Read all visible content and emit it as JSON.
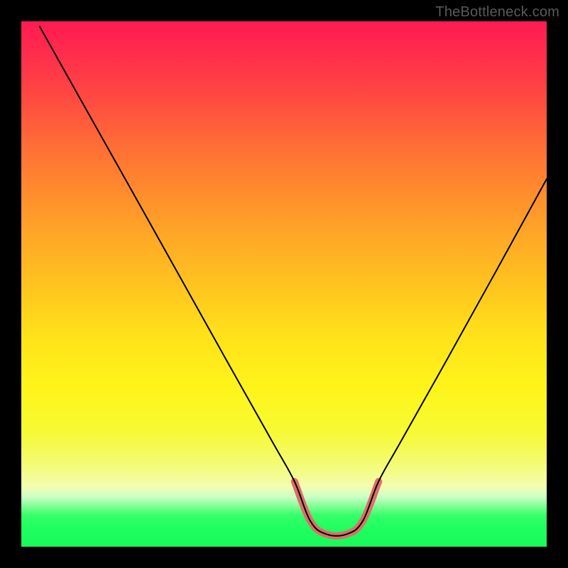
{
  "watermark": "TheBottleneck.com",
  "chart_data": {
    "type": "line",
    "title": "",
    "xlabel": "",
    "ylabel": "",
    "xlim": [
      0,
      100
    ],
    "ylim": [
      0,
      100
    ],
    "grid": false,
    "legend": false,
    "note": "V-shaped bottleneck curve over rainbow gradient; minimum ≈0 around x≈55–65. Values inferred from pixel geometry.",
    "series": [
      {
        "name": "bottleneck-curve",
        "color": "#000000",
        "x": [
          3.5,
          10,
          20,
          30,
          40,
          48,
          52,
          55,
          58,
          62,
          65,
          68,
          72,
          80,
          90,
          100
        ],
        "y": [
          99,
          87.4,
          69.6,
          51.7,
          33.8,
          19.6,
          12.4,
          4.9,
          2.4,
          2.4,
          4.9,
          12.4,
          19.6,
          33.8,
          51.8,
          70
        ]
      },
      {
        "name": "optimal-range-highlight",
        "color": "#dd6e6a",
        "x": [
          52,
          55,
          58,
          62,
          65,
          68
        ],
        "y": [
          12.4,
          4.9,
          2.4,
          2.4,
          4.9,
          12.4
        ]
      }
    ]
  }
}
